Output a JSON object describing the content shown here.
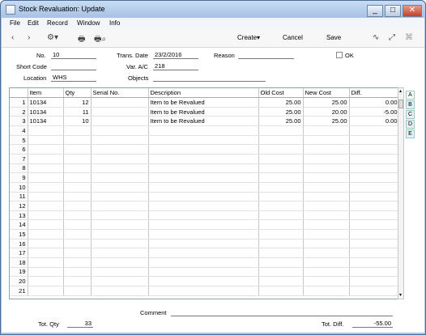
{
  "window": {
    "title": "Stock Revaluation: Update",
    "buttons": [
      "_",
      "□",
      "✕"
    ]
  },
  "menu": [
    "File",
    "Edit",
    "Record",
    "Window",
    "Info"
  ],
  "toolbar": {
    "prev": "‹",
    "next": "›",
    "create": "Create",
    "cancel": "Cancel",
    "save": "Save"
  },
  "header": {
    "no_label": "No.",
    "no": "10",
    "trans_date_label": "Trans. Date",
    "trans_date": "23/2/2016",
    "reason_label": "Reason",
    "reason": "",
    "ok_label": "OK",
    "short_code_label": "Short Code",
    "short_code": "",
    "var_ac_label": "Var. A/C",
    "var_ac": "218",
    "location_label": "Location",
    "location": "WHS",
    "objects_label": "Objects",
    "objects": ""
  },
  "grid": {
    "columns": [
      "",
      "Item",
      "Qty",
      "Serial No.",
      "Description",
      "Old Cost",
      "New Cost",
      "Diff."
    ],
    "rows": [
      [
        "1",
        "10134",
        "12",
        "",
        "Item to be Revalued",
        "25.00",
        "25.00",
        "0.00"
      ],
      [
        "2",
        "10134",
        "11",
        "",
        "Item to be Revalued",
        "25.00",
        "20.00",
        "-5.00"
      ],
      [
        "3",
        "10134",
        "10",
        "",
        "Item to be Revalued",
        "25.00",
        "25.00",
        "0.00"
      ],
      [
        "4",
        "",
        "",
        "",
        "",
        "",
        "",
        ""
      ],
      [
        "5",
        "",
        "",
        "",
        "",
        "",
        "",
        ""
      ],
      [
        "6",
        "",
        "",
        "",
        "",
        "",
        "",
        ""
      ],
      [
        "7",
        "",
        "",
        "",
        "",
        "",
        "",
        ""
      ],
      [
        "8",
        "",
        "",
        "",
        "",
        "",
        "",
        ""
      ],
      [
        "9",
        "",
        "",
        "",
        "",
        "",
        "",
        ""
      ],
      [
        "10",
        "",
        "",
        "",
        "",
        "",
        "",
        ""
      ],
      [
        "11",
        "",
        "",
        "",
        "",
        "",
        "",
        ""
      ],
      [
        "12",
        "",
        "",
        "",
        "",
        "",
        "",
        ""
      ],
      [
        "13",
        "",
        "",
        "",
        "",
        "",
        "",
        ""
      ],
      [
        "14",
        "",
        "",
        "",
        "",
        "",
        "",
        ""
      ],
      [
        "15",
        "",
        "",
        "",
        "",
        "",
        "",
        ""
      ],
      [
        "16",
        "",
        "",
        "",
        "",
        "",
        "",
        ""
      ],
      [
        "17",
        "",
        "",
        "",
        "",
        "",
        "",
        ""
      ],
      [
        "18",
        "",
        "",
        "",
        "",
        "",
        "",
        ""
      ],
      [
        "19",
        "",
        "",
        "",
        "",
        "",
        "",
        ""
      ],
      [
        "20",
        "",
        "",
        "",
        "",
        "",
        "",
        ""
      ],
      [
        "21",
        "",
        "",
        "",
        "",
        "",
        "",
        ""
      ]
    ]
  },
  "tabs": [
    "A",
    "B",
    "C",
    "D",
    "E"
  ],
  "footer": {
    "comment_label": "Comment",
    "comment": "",
    "tot_qty_label": "Tot. Qty",
    "tot_qty": "33",
    "tot_diff_label": "Tot. Diff.",
    "tot_diff": "-55.00"
  }
}
